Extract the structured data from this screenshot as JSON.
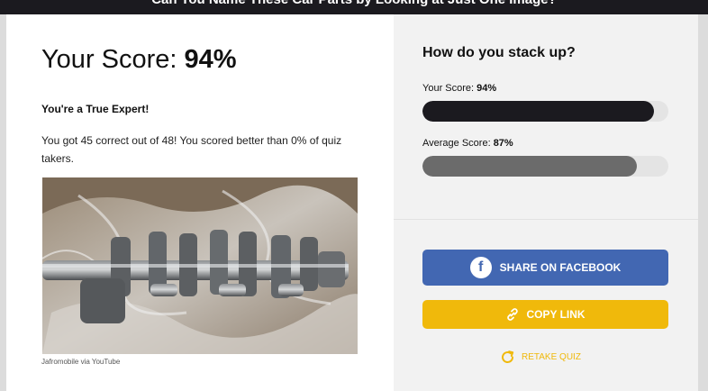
{
  "header": {
    "title": "Can You Name These Car Parts by Looking at Just One Image?"
  },
  "result": {
    "score_prefix": "Your Score: ",
    "score_value": "94%",
    "rank_title": "You're a True Expert!",
    "summary": "You got 45 correct out of 48! You scored better than 0% of quiz takers.",
    "image_credit": "Jafromobile via YouTube"
  },
  "comparison": {
    "title": "How do you stack up?",
    "your_label": "Your Score: ",
    "your_value": "94%",
    "your_fraction": 0.94,
    "your_color": "#1b1a1f",
    "average_label": "Average Score: ",
    "average_value": "87%",
    "average_fraction": 0.87,
    "average_color": "#6b6b6b"
  },
  "actions": {
    "facebook_label": "SHARE ON FACEBOOK",
    "facebook_icon": "facebook-icon",
    "facebook_color": "#4267b2",
    "copy_label": "COPY LINK",
    "copy_icon": "link-icon",
    "copy_color": "#f0b90b",
    "retake_label": "RETAKE QUIZ",
    "retake_icon": "refresh-icon"
  }
}
